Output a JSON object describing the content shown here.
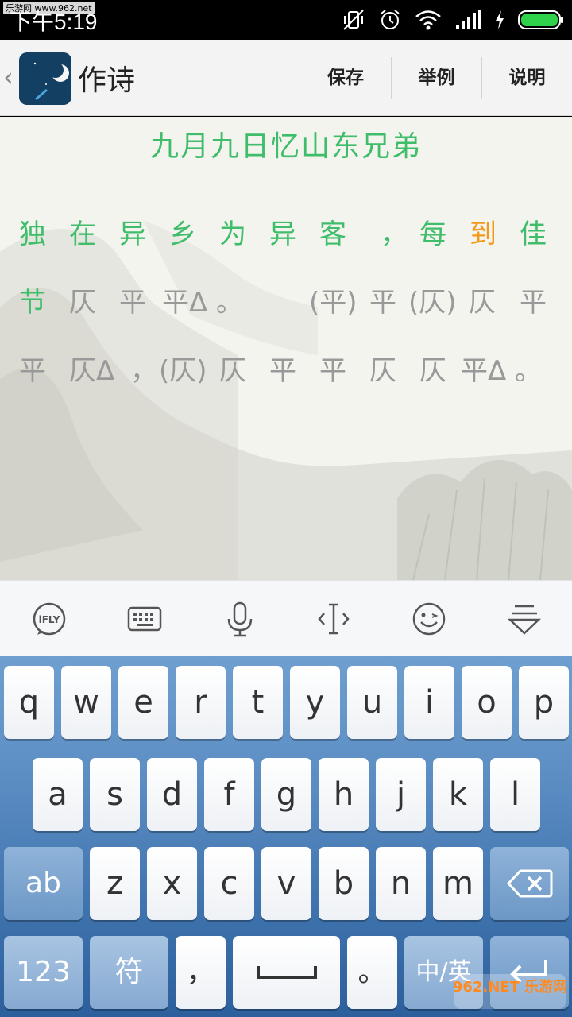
{
  "status_bar": {
    "time": "下午5:19",
    "watermark": "乐游网 www.962.net"
  },
  "app_bar": {
    "back_glyph": "‹",
    "title": "作诗",
    "actions": [
      "保存",
      "举例",
      "说明"
    ]
  },
  "poem": {
    "title": "九月九日忆山东兄弟",
    "line1": [
      {
        "t": "独",
        "c": "green"
      },
      {
        "t": "在",
        "c": "green"
      },
      {
        "t": "异",
        "c": "green"
      },
      {
        "t": "乡",
        "c": "green"
      },
      {
        "t": "为",
        "c": "green"
      },
      {
        "t": "异",
        "c": "green"
      },
      {
        "t": "客",
        "c": "green"
      },
      {
        "t": "，",
        "c": "green"
      },
      {
        "t": "每",
        "c": "green"
      },
      {
        "t": "到",
        "c": "orange"
      },
      {
        "t": "佳",
        "c": "green"
      }
    ],
    "line2": [
      {
        "t": "节",
        "c": "green"
      },
      {
        "t": "仄",
        "c": "gray"
      },
      {
        "t": "平",
        "c": "gray"
      },
      {
        "t": "平Δ",
        "c": "gray"
      },
      {
        "t": "。",
        "c": "gray"
      },
      {
        "t": "(平)",
        "c": "gray"
      },
      {
        "t": "平",
        "c": "gray"
      },
      {
        "t": "(仄)",
        "c": "gray"
      },
      {
        "t": "仄",
        "c": "gray"
      },
      {
        "t": "平",
        "c": "gray"
      }
    ],
    "line3": [
      {
        "t": "平",
        "c": "gray"
      },
      {
        "t": "仄Δ",
        "c": "gray"
      },
      {
        "t": "，",
        "c": "gray"
      },
      {
        "t": "(仄)",
        "c": "gray"
      },
      {
        "t": "仄",
        "c": "gray"
      },
      {
        "t": "平",
        "c": "gray"
      },
      {
        "t": "平",
        "c": "gray"
      },
      {
        "t": "仄",
        "c": "gray"
      },
      {
        "t": "仄",
        "c": "gray"
      },
      {
        "t": "平Δ",
        "c": "gray"
      },
      {
        "t": "。",
        "c": "gray"
      }
    ]
  },
  "keyboard": {
    "toolbar_icons": [
      "ifly-icon",
      "keyboard-icon",
      "microphone-icon",
      "cursor-icon",
      "emoji-icon",
      "hide-keyboard-icon"
    ],
    "ifly_label": "iFLY",
    "row1": [
      "q",
      "w",
      "e",
      "r",
      "t",
      "y",
      "u",
      "i",
      "o",
      "p"
    ],
    "row2": [
      "a",
      "s",
      "d",
      "f",
      "g",
      "h",
      "j",
      "k",
      "l"
    ],
    "row3": [
      "z",
      "x",
      "c",
      "v",
      "b",
      "n",
      "m"
    ],
    "abc_label": "ab",
    "num_label": "123",
    "symbol_label": "符",
    "comma_label": "，",
    "period_label": "。",
    "lang_label": "中/英"
  },
  "site_watermark": "962.NET 乐游网",
  "colors": {
    "poem_green": "#3fbd6a",
    "highlight_orange": "#f39a1d",
    "tone_gray": "#999999",
    "keyboard_blue": "#4f83bd"
  }
}
